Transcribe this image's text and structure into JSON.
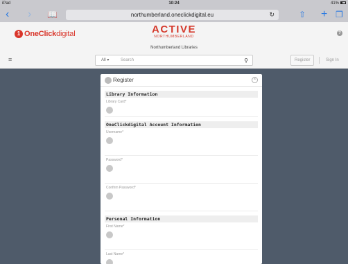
{
  "status": {
    "device": "iPad",
    "time": "10:24",
    "battery": "41%"
  },
  "browser": {
    "url": "northumberland.oneclickdigital.eu"
  },
  "header": {
    "logo_text_bold": "OneClick",
    "logo_text_thin": "digital",
    "brand_title": "ACTIVE",
    "brand_subtitle": "NORTHUMBERLAND",
    "library_name": "Northumberland Libraries"
  },
  "search": {
    "scope": "All",
    "placeholder": "Search"
  },
  "auth": {
    "register": "Register",
    "sign_in": "Sign In"
  },
  "modal": {
    "title": "Register",
    "sections": [
      {
        "title": "Library Information",
        "fields": [
          "Library Card*"
        ]
      },
      {
        "title": "OneClickdigital Account Information",
        "fields": [
          "Username*",
          "Password*",
          "Confirm Password*"
        ]
      },
      {
        "title": "Personal Information",
        "fields": [
          "First Name*",
          "Last Name*"
        ]
      }
    ]
  }
}
